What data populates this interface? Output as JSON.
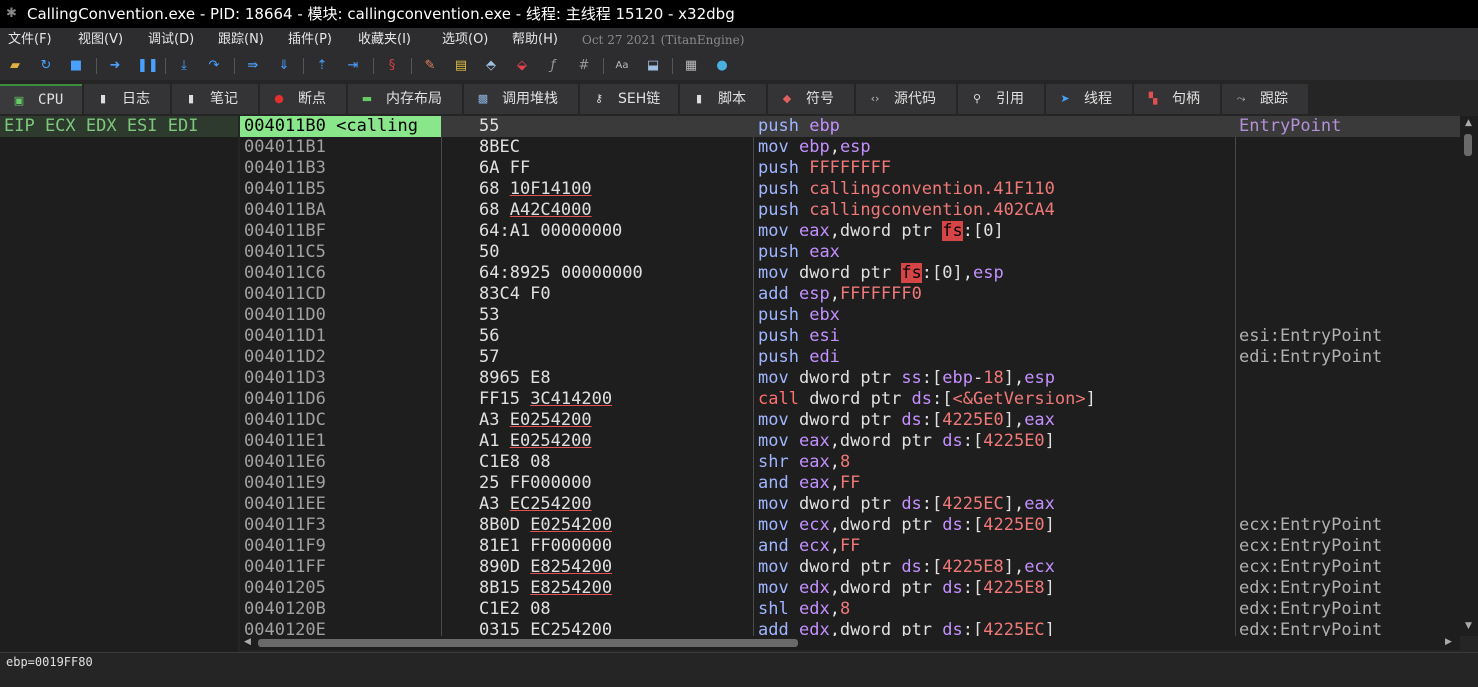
{
  "title": "CallingConvention.exe - PID: 18664 - 模块: callingconvention.exe - 线程: 主线程 15120 - x32dbg",
  "menu": [
    "文件(F)",
    "视图(V)",
    "调试(D)",
    "跟踪(N)",
    "插件(P)",
    "收藏夹(I)",
    "选项(O)",
    "帮助(H)"
  ],
  "version": "Oct 27 2021 (TitanEngine)",
  "tabs": [
    "CPU",
    "日志",
    "笔记",
    "断点",
    "内存布局",
    "调用堆栈",
    "SEH链",
    "脚本",
    "符号",
    "源代码",
    "引用",
    "线程",
    "句柄",
    "跟踪"
  ],
  "registers_header": "EIP ECX EDX ESI EDI",
  "status": "ebp=0019FF80",
  "disasm": [
    {
      "addr": "004011B0 <calling",
      "bytes": [
        {
          "t": "55"
        }
      ],
      "ins": [
        {
          "t": "push",
          "k": "mn"
        },
        {
          "t": " "
        },
        {
          "t": "ebp",
          "k": "reg"
        }
      ],
      "cmt": "EntryPoint",
      "sel": true
    },
    {
      "addr": "004011B1",
      "bytes": [
        {
          "t": "8BEC"
        }
      ],
      "ins": [
        {
          "t": "mov",
          "k": "mn"
        },
        {
          "t": " "
        },
        {
          "t": "ebp",
          "k": "reg"
        },
        {
          "t": ","
        },
        {
          "t": "esp",
          "k": "reg"
        }
      ],
      "cmt": ""
    },
    {
      "addr": "004011B3",
      "bytes": [
        {
          "t": "6A FF"
        }
      ],
      "ins": [
        {
          "t": "push",
          "k": "mn"
        },
        {
          "t": " "
        },
        {
          "t": "FFFFFFFF",
          "k": "num"
        }
      ],
      "cmt": ""
    },
    {
      "addr": "004011B5",
      "bytes": [
        {
          "t": "68 "
        },
        {
          "t": "10F14100",
          "k": "ul"
        }
      ],
      "ins": [
        {
          "t": "push",
          "k": "mn"
        },
        {
          "t": " "
        },
        {
          "t": "callingconvention.41F110",
          "k": "num"
        }
      ],
      "cmt": ""
    },
    {
      "addr": "004011BA",
      "bytes": [
        {
          "t": "68 "
        },
        {
          "t": "A42C4000",
          "k": "ul"
        }
      ],
      "ins": [
        {
          "t": "push",
          "k": "mn"
        },
        {
          "t": " "
        },
        {
          "t": "callingconvention.402CA4",
          "k": "num"
        }
      ],
      "cmt": ""
    },
    {
      "addr": "004011BF",
      "bytes": [
        {
          "t": "64:A1 00000000"
        }
      ],
      "ins": [
        {
          "t": "mov",
          "k": "mn"
        },
        {
          "t": " "
        },
        {
          "t": "eax",
          "k": "reg"
        },
        {
          "t": ",dword ptr "
        },
        {
          "t": "fs",
          "k": "fsh"
        },
        {
          "t": ":[0]"
        }
      ],
      "cmt": ""
    },
    {
      "addr": "004011C5",
      "bytes": [
        {
          "t": "50"
        }
      ],
      "ins": [
        {
          "t": "push",
          "k": "mn"
        },
        {
          "t": " "
        },
        {
          "t": "eax",
          "k": "reg"
        }
      ],
      "cmt": ""
    },
    {
      "addr": "004011C6",
      "bytes": [
        {
          "t": "64:8925 00000000"
        }
      ],
      "ins": [
        {
          "t": "mov",
          "k": "mn"
        },
        {
          "t": " dword ptr "
        },
        {
          "t": "fs",
          "k": "fsh"
        },
        {
          "t": ":[0],"
        },
        {
          "t": "esp",
          "k": "reg"
        }
      ],
      "cmt": ""
    },
    {
      "addr": "004011CD",
      "bytes": [
        {
          "t": "83C4 F0"
        }
      ],
      "ins": [
        {
          "t": "add",
          "k": "mn"
        },
        {
          "t": " "
        },
        {
          "t": "esp",
          "k": "reg"
        },
        {
          "t": ","
        },
        {
          "t": "FFFFFFF0",
          "k": "num"
        }
      ],
      "cmt": ""
    },
    {
      "addr": "004011D0",
      "bytes": [
        {
          "t": "53"
        }
      ],
      "ins": [
        {
          "t": "push",
          "k": "mn"
        },
        {
          "t": " "
        },
        {
          "t": "ebx",
          "k": "reg"
        }
      ],
      "cmt": ""
    },
    {
      "addr": "004011D1",
      "bytes": [
        {
          "t": "56"
        }
      ],
      "ins": [
        {
          "t": "push",
          "k": "mn"
        },
        {
          "t": " "
        },
        {
          "t": "esi",
          "k": "reg"
        }
      ],
      "cmt": "esi:EntryPoint"
    },
    {
      "addr": "004011D2",
      "bytes": [
        {
          "t": "57"
        }
      ],
      "ins": [
        {
          "t": "push",
          "k": "mn"
        },
        {
          "t": " "
        },
        {
          "t": "edi",
          "k": "reg"
        }
      ],
      "cmt": "edi:EntryPoint"
    },
    {
      "addr": "004011D3",
      "bytes": [
        {
          "t": "8965 E8"
        }
      ],
      "ins": [
        {
          "t": "mov",
          "k": "mn"
        },
        {
          "t": " dword ptr "
        },
        {
          "t": "ss",
          "k": "seg"
        },
        {
          "t": ":["
        },
        {
          "t": "ebp",
          "k": "reg"
        },
        {
          "t": "-"
        },
        {
          "t": "18",
          "k": "num"
        },
        {
          "t": "],"
        },
        {
          "t": "esp",
          "k": "reg"
        }
      ],
      "cmt": ""
    },
    {
      "addr": "004011D6",
      "bytes": [
        {
          "t": "FF15 "
        },
        {
          "t": "3C414200",
          "k": "ul"
        }
      ],
      "ins": [
        {
          "t": "call",
          "k": "call"
        },
        {
          "t": " dword ptr "
        },
        {
          "t": "ds",
          "k": "seg"
        },
        {
          "t": ":["
        },
        {
          "t": "<&GetVersion>",
          "k": "num"
        },
        {
          "t": "]"
        }
      ],
      "cmt": ""
    },
    {
      "addr": "004011DC",
      "bytes": [
        {
          "t": "A3 "
        },
        {
          "t": "E0254200",
          "k": "ul"
        }
      ],
      "ins": [
        {
          "t": "mov",
          "k": "mn"
        },
        {
          "t": " dword ptr "
        },
        {
          "t": "ds",
          "k": "seg"
        },
        {
          "t": ":["
        },
        {
          "t": "4225E0",
          "k": "num"
        },
        {
          "t": "],"
        },
        {
          "t": "eax",
          "k": "reg"
        }
      ],
      "cmt": ""
    },
    {
      "addr": "004011E1",
      "bytes": [
        {
          "t": "A1 "
        },
        {
          "t": "E0254200",
          "k": "ul"
        }
      ],
      "ins": [
        {
          "t": "mov",
          "k": "mn"
        },
        {
          "t": " "
        },
        {
          "t": "eax",
          "k": "reg"
        },
        {
          "t": ",dword ptr "
        },
        {
          "t": "ds",
          "k": "seg"
        },
        {
          "t": ":["
        },
        {
          "t": "4225E0",
          "k": "num"
        },
        {
          "t": "]"
        }
      ],
      "cmt": ""
    },
    {
      "addr": "004011E6",
      "bytes": [
        {
          "t": "C1E8 08"
        }
      ],
      "ins": [
        {
          "t": "shr",
          "k": "mn"
        },
        {
          "t": " "
        },
        {
          "t": "eax",
          "k": "reg"
        },
        {
          "t": ","
        },
        {
          "t": "8",
          "k": "num"
        }
      ],
      "cmt": ""
    },
    {
      "addr": "004011E9",
      "bytes": [
        {
          "t": "25 FF000000"
        }
      ],
      "ins": [
        {
          "t": "and",
          "k": "mn"
        },
        {
          "t": " "
        },
        {
          "t": "eax",
          "k": "reg"
        },
        {
          "t": ","
        },
        {
          "t": "FF",
          "k": "num"
        }
      ],
      "cmt": ""
    },
    {
      "addr": "004011EE",
      "bytes": [
        {
          "t": "A3 "
        },
        {
          "t": "EC254200",
          "k": "ul"
        }
      ],
      "ins": [
        {
          "t": "mov",
          "k": "mn"
        },
        {
          "t": " dword ptr "
        },
        {
          "t": "ds",
          "k": "seg"
        },
        {
          "t": ":["
        },
        {
          "t": "4225EC",
          "k": "num"
        },
        {
          "t": "],"
        },
        {
          "t": "eax",
          "k": "reg"
        }
      ],
      "cmt": ""
    },
    {
      "addr": "004011F3",
      "bytes": [
        {
          "t": "8B0D "
        },
        {
          "t": "E0254200",
          "k": "ul"
        }
      ],
      "ins": [
        {
          "t": "mov",
          "k": "mn"
        },
        {
          "t": " "
        },
        {
          "t": "ecx",
          "k": "reg"
        },
        {
          "t": ",dword ptr "
        },
        {
          "t": "ds",
          "k": "seg"
        },
        {
          "t": ":["
        },
        {
          "t": "4225E0",
          "k": "num"
        },
        {
          "t": "]"
        }
      ],
      "cmt": "ecx:EntryPoint"
    },
    {
      "addr": "004011F9",
      "bytes": [
        {
          "t": "81E1 FF000000"
        }
      ],
      "ins": [
        {
          "t": "and",
          "k": "mn"
        },
        {
          "t": " "
        },
        {
          "t": "ecx",
          "k": "reg"
        },
        {
          "t": ","
        },
        {
          "t": "FF",
          "k": "num"
        }
      ],
      "cmt": "ecx:EntryPoint"
    },
    {
      "addr": "004011FF",
      "bytes": [
        {
          "t": "890D "
        },
        {
          "t": "E8254200",
          "k": "ul"
        }
      ],
      "ins": [
        {
          "t": "mov",
          "k": "mn"
        },
        {
          "t": " dword ptr "
        },
        {
          "t": "ds",
          "k": "seg"
        },
        {
          "t": ":["
        },
        {
          "t": "4225E8",
          "k": "num"
        },
        {
          "t": "],"
        },
        {
          "t": "ecx",
          "k": "reg"
        }
      ],
      "cmt": "ecx:EntryPoint"
    },
    {
      "addr": "00401205",
      "bytes": [
        {
          "t": "8B15 "
        },
        {
          "t": "E8254200",
          "k": "ul"
        }
      ],
      "ins": [
        {
          "t": "mov",
          "k": "mn"
        },
        {
          "t": " "
        },
        {
          "t": "edx",
          "k": "reg"
        },
        {
          "t": ",dword ptr "
        },
        {
          "t": "ds",
          "k": "seg"
        },
        {
          "t": ":["
        },
        {
          "t": "4225E8",
          "k": "num"
        },
        {
          "t": "]"
        }
      ],
      "cmt": "edx:EntryPoint"
    },
    {
      "addr": "0040120B",
      "bytes": [
        {
          "t": "C1E2 08"
        }
      ],
      "ins": [
        {
          "t": "shl",
          "k": "mn"
        },
        {
          "t": " "
        },
        {
          "t": "edx",
          "k": "reg"
        },
        {
          "t": ","
        },
        {
          "t": "8",
          "k": "num"
        }
      ],
      "cmt": "edx:EntryPoint"
    },
    {
      "addr": "0040120E",
      "bytes": [
        {
          "t": "0315 "
        },
        {
          "t": "EC254200",
          "k": "ul"
        }
      ],
      "ins": [
        {
          "t": "add",
          "k": "mn"
        },
        {
          "t": " "
        },
        {
          "t": "edx",
          "k": "reg"
        },
        {
          "t": ",dword ptr "
        },
        {
          "t": "ds",
          "k": "seg"
        },
        {
          "t": ":["
        },
        {
          "t": "4225EC",
          "k": "num"
        },
        {
          "t": "]"
        }
      ],
      "cmt": "edx:EntryPoint"
    }
  ]
}
